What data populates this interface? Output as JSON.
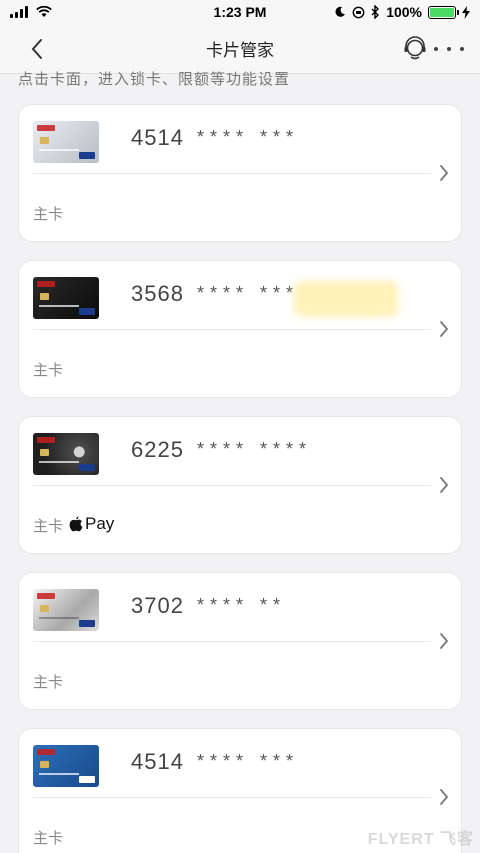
{
  "status_bar": {
    "time": "1:23 PM",
    "battery": "100%",
    "battery_level": 1.0
  },
  "nav": {
    "title": "卡片管家",
    "back_icon": "chevron-left-icon",
    "service_icon": "customer-service-icon",
    "more_icon": "more-icon"
  },
  "hint": "点击卡面，进入锁卡、限额等功能设置",
  "cards": [
    {
      "prefix": "4514",
      "mask": "****  ***",
      "type": "主卡",
      "thumb": "silver",
      "apple_pay": ""
    },
    {
      "prefix": "3568",
      "mask": "****  ***",
      "type": "主卡",
      "thumb": "black",
      "apple_pay": ""
    },
    {
      "prefix": "6225",
      "mask": "****  ****",
      "type": "主卡",
      "thumb": "darkgray",
      "apple_pay": "Pay"
    },
    {
      "prefix": "3702",
      "mask": "****  **",
      "type": "主卡",
      "thumb": "platinum",
      "apple_pay": ""
    },
    {
      "prefix": "4514",
      "mask": "****  ***",
      "type": "主卡",
      "thumb": "blue",
      "apple_pay": ""
    }
  ],
  "watermark": "FLYERT 飞客",
  "colors": {
    "background": "#f2f2f4",
    "card": "#ffffff",
    "battery_green": "#4cd964"
  }
}
